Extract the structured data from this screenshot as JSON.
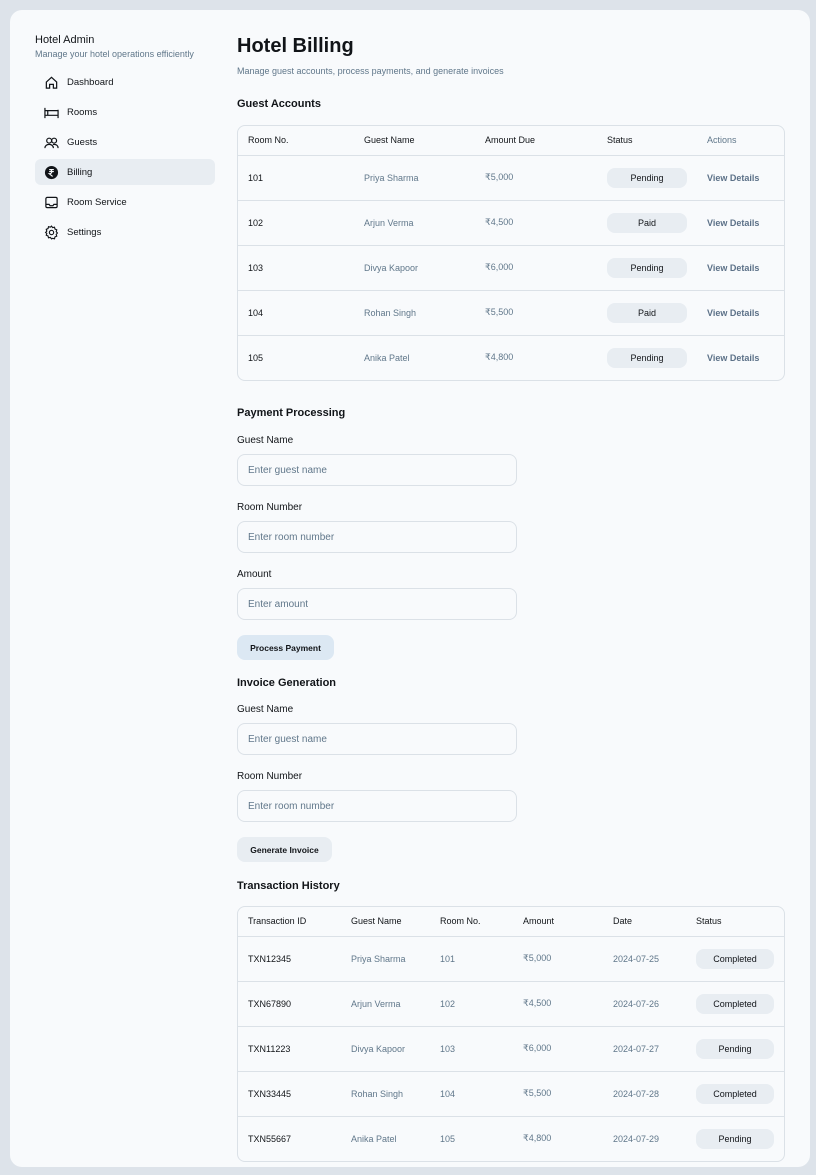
{
  "sidebar": {
    "title": "Hotel Admin",
    "subtitle": "Manage your hotel operations efficiently",
    "items": [
      {
        "label": "Dashboard",
        "icon": "house-icon"
      },
      {
        "label": "Rooms",
        "icon": "bed-icon"
      },
      {
        "label": "Guests",
        "icon": "users-icon"
      },
      {
        "label": "Billing",
        "icon": "rupee-icon",
        "active": true
      },
      {
        "label": "Room Service",
        "icon": "tray-icon"
      },
      {
        "label": "Settings",
        "icon": "gear-icon"
      }
    ]
  },
  "header": {
    "title": "Hotel Billing",
    "subtitle": "Manage guest accounts, process payments, and generate invoices"
  },
  "guest_accounts": {
    "title": "Guest Accounts",
    "columns": [
      "Room No.",
      "Guest Name",
      "Amount Due",
      "Status",
      "Actions"
    ],
    "rows": [
      {
        "room": "101",
        "guest": "Priya Sharma",
        "amount": "₹5,000",
        "status": "Pending",
        "action": "View Details"
      },
      {
        "room": "102",
        "guest": "Arjun Verma",
        "amount": "₹4,500",
        "status": "Paid",
        "action": "View Details"
      },
      {
        "room": "103",
        "guest": "Divya Kapoor",
        "amount": "₹6,000",
        "status": "Pending",
        "action": "View Details"
      },
      {
        "room": "104",
        "guest": "Rohan Singh",
        "amount": "₹5,500",
        "status": "Paid",
        "action": "View Details"
      },
      {
        "room": "105",
        "guest": "Anika Patel",
        "amount": "₹4,800",
        "status": "Pending",
        "action": "View Details"
      }
    ]
  },
  "payment": {
    "title": "Payment Processing",
    "guest_label": "Guest Name",
    "guest_placeholder": "Enter guest name",
    "room_label": "Room Number",
    "room_placeholder": "Enter room number",
    "amount_label": "Amount",
    "amount_placeholder": "Enter amount",
    "button": "Process Payment"
  },
  "invoice": {
    "title": "Invoice Generation",
    "guest_label": "Guest Name",
    "guest_placeholder": "Enter guest name",
    "room_label": "Room Number",
    "room_placeholder": "Enter room number",
    "button": "Generate Invoice"
  },
  "transactions": {
    "title": "Transaction History",
    "columns": [
      "Transaction ID",
      "Guest Name",
      "Room No.",
      "Amount",
      "Date",
      "Status"
    ],
    "rows": [
      {
        "id": "TXN12345",
        "guest": "Priya Sharma",
        "room": "101",
        "amount": "₹5,000",
        "date": "2024-07-25",
        "status": "Completed"
      },
      {
        "id": "TXN67890",
        "guest": "Arjun Verma",
        "room": "102",
        "amount": "₹4,500",
        "date": "2024-07-26",
        "status": "Completed"
      },
      {
        "id": "TXN11223",
        "guest": "Divya Kapoor",
        "room": "103",
        "amount": "₹6,000",
        "date": "2024-07-27",
        "status": "Pending"
      },
      {
        "id": "TXN33445",
        "guest": "Rohan Singh",
        "room": "104",
        "amount": "₹5,500",
        "date": "2024-07-28",
        "status": "Completed"
      },
      {
        "id": "TXN55667",
        "guest": "Anika Patel",
        "room": "105",
        "amount": "₹4,800",
        "date": "2024-07-29",
        "status": "Pending"
      }
    ]
  },
  "colors": {
    "background": "#f8fafc",
    "muted_text": "#60778a",
    "pill": "#e8edf2",
    "primary_button": "#dce8f3"
  }
}
